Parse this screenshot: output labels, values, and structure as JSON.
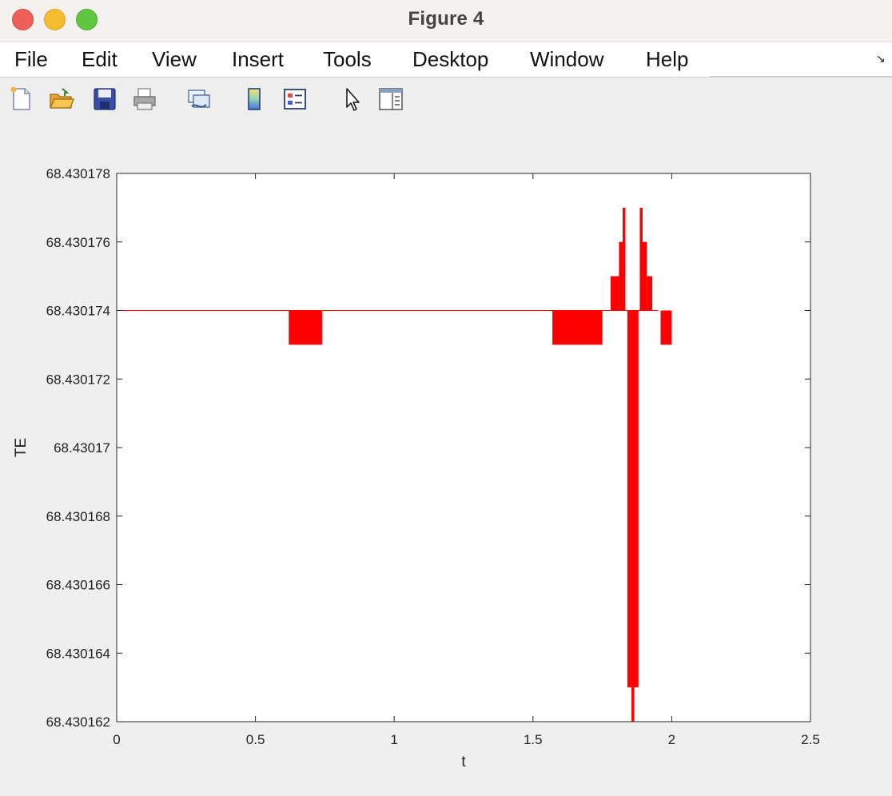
{
  "window": {
    "title": "Figure 4"
  },
  "menu": {
    "items": [
      "File",
      "Edit",
      "View",
      "Insert",
      "Tools",
      "Desktop",
      "Window",
      "Help"
    ]
  },
  "toolbar": {
    "buttons": [
      {
        "icon": "new-figure-icon"
      },
      {
        "icon": "open-file-icon"
      },
      {
        "icon": "save-icon"
      },
      {
        "icon": "print-icon"
      },
      {
        "icon": "link-plot-icon"
      },
      {
        "icon": "colorbar-icon"
      },
      {
        "icon": "legend-icon"
      },
      {
        "icon": "pointer-icon"
      },
      {
        "icon": "property-editor-icon"
      }
    ]
  },
  "chart_data": {
    "type": "line",
    "xlabel": "t",
    "ylabel": "TE",
    "xlim": [
      0,
      2.5
    ],
    "ylim": [
      68.430162,
      68.430178
    ],
    "xticks": [
      0,
      0.5,
      1,
      1.5,
      2,
      2.5
    ],
    "xtick_labels": [
      "0",
      "0.5",
      "1",
      "1.5",
      "2",
      "2.5"
    ],
    "yticks": [
      68.430162,
      68.430164,
      68.430166,
      68.430168,
      68.43017,
      68.430172,
      68.430174,
      68.430176,
      68.430178
    ],
    "ytick_labels": [
      "68.430162",
      "68.430164",
      "68.430166",
      "68.430168",
      "68.43017",
      "68.430172",
      "68.430174",
      "68.430176",
      "68.430178"
    ],
    "grid": false,
    "series": [
      {
        "color": "#ff0000",
        "baseline": 68.430174,
        "baseline_range": [
          0,
          1.95
        ],
        "bands": [
          {
            "x": [
              0.62,
              0.74
            ],
            "y": [
              68.430173,
              68.430174
            ]
          },
          {
            "x": [
              1.57,
              1.75
            ],
            "y": [
              68.430173,
              68.430174
            ]
          },
          {
            "x": [
              1.78,
              1.81
            ],
            "y": [
              68.430174,
              68.430175
            ]
          },
          {
            "x": [
              1.81,
              1.83
            ],
            "y": [
              68.430174,
              68.430176
            ]
          },
          {
            "x": [
              1.823,
              1.833
            ],
            "y": [
              68.430174,
              68.430177
            ]
          },
          {
            "x": [
              1.84,
              1.88
            ],
            "y": [
              68.430163,
              68.430174
            ]
          },
          {
            "x": [
              1.855,
              1.865
            ],
            "y": [
              68.430162,
              68.430165
            ]
          },
          {
            "x": [
              1.885,
              1.895
            ],
            "y": [
              68.430174,
              68.430177
            ]
          },
          {
            "x": [
              1.89,
              1.91
            ],
            "y": [
              68.430174,
              68.430176
            ]
          },
          {
            "x": [
              1.91,
              1.93
            ],
            "y": [
              68.430174,
              68.430175
            ]
          },
          {
            "x": [
              1.96,
              2.0
            ],
            "y": [
              68.430173,
              68.430174
            ]
          }
        ]
      }
    ]
  }
}
